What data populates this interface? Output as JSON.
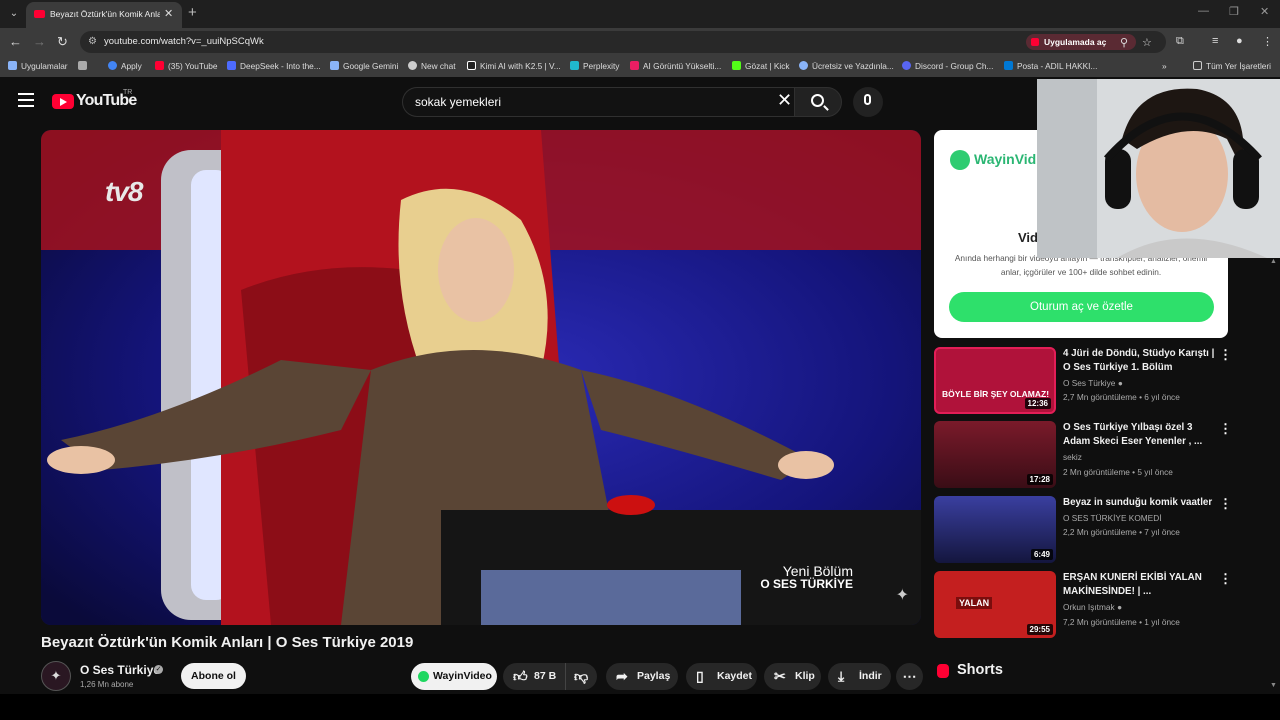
{
  "browser": {
    "tab_title": "Beyazıt Öztürk'ün Komik Anları",
    "url": "youtube.com/watch?v=_uuiNpSCqWk",
    "open_in_app": "Uygulamada aç",
    "bookmarks": [
      {
        "label": "Uygulamalar",
        "icon": "apps-grid-icon",
        "color": "#8ab4f8"
      },
      {
        "label": "Apply",
        "icon": "apply-icon",
        "color": "#4285f4"
      },
      {
        "label": "(35) YouTube",
        "icon": "youtube-icon",
        "color": "#ff0033"
      },
      {
        "label": "DeepSeek - Into the...",
        "icon": "deepseek-icon",
        "color": "#4d6bfe"
      },
      {
        "label": "Google Gemini",
        "icon": "gemini-icon",
        "color": "#8ab4f8"
      },
      {
        "label": "New chat",
        "icon": "chatgpt-icon",
        "color": "#cccccc"
      },
      {
        "label": "Kimi AI with K2.5 | V...",
        "icon": "kimi-icon",
        "color": "#ffffff"
      },
      {
        "label": "Perplexity",
        "icon": "perplexity-icon",
        "color": "#20b8cd"
      },
      {
        "label": "AI Görüntü Yükselti...",
        "icon": "upscale-icon",
        "color": "#e91e63"
      },
      {
        "label": "Gözat | Kick",
        "icon": "kick-icon",
        "color": "#53fc18"
      },
      {
        "label": "Ücretsiz ve Yazdınla...",
        "icon": "free-icon",
        "color": "#8ab4f8"
      },
      {
        "label": "Discord - Group Ch...",
        "icon": "discord-icon",
        "color": "#5865f2"
      },
      {
        "label": "Posta - ADIL HAKKI...",
        "icon": "mail-icon",
        "color": "#0078d4"
      }
    ],
    "all_bookmarks": "Tüm Yer İşaretleri"
  },
  "youtube": {
    "logo": "YouTube",
    "region": "TR",
    "search_query": "sokak yemekleri",
    "player": {
      "channel_logo": "tv8",
      "caption_line1": "Yeni Bölüm",
      "caption_line2": "O SES TÜRKİYE"
    },
    "video": {
      "title": "Beyazıt Öztürk'ün Komik Anları | O Ses Türkiye 2019",
      "channel": "O Ses Türkiye",
      "subscribers": "1,26 Mn abone",
      "subscribe": "Abone ol",
      "actions": {
        "wayin": "WayinVideo",
        "likes": "87 B",
        "share": "Paylaş",
        "save": "Kaydet",
        "clip": "Klip",
        "download": "İndir"
      }
    },
    "ad": {
      "brand": "WayinVid",
      "heading": "Vid",
      "description": "Anında herhangi bir videoyu anlayın — transkriptler, analizler, önemli anlar, içgörüler ve 100+ dilde sohbet edinin.",
      "cta": "Oturum aç ve özetle"
    },
    "recommendations": [
      {
        "title": "4 Jüri de Döndü, Stüdyo Karıştı | O Ses Türkiye 1. Bölüm",
        "channel": "O Ses Türkiye",
        "verified": true,
        "stats": "2,7 Mn görüntüleme • 6 yıl önce",
        "duration": "12:36",
        "thumb_text": "BÖYLE BİR ŞEY OLAMAZ!",
        "thumb_color": "#b0123a"
      },
      {
        "title": "O Ses Türkiye Yılbaşı özel 3 Adam Skeci Eser Yenenler , ...",
        "channel": "sekiz",
        "verified": false,
        "stats": "2 Mn görüntüleme • 5 yıl önce",
        "duration": "17:28",
        "thumb_text": "",
        "thumb_color": "#6b1526"
      },
      {
        "title": "Beyaz in sunduğu komik vaatler",
        "channel": "O SES TÜRKİYE KOMEDİ",
        "verified": false,
        "stats": "2,2 Mn görüntüleme • 7 yıl önce",
        "duration": "6:49",
        "thumb_text": "",
        "thumb_color": "#2a2f7a"
      },
      {
        "title": "ERŞAN KUNERİ EKİBİ YALAN MAKİNESİNDE! | ...",
        "channel": "Orkun Işıtmak",
        "verified": true,
        "stats": "7,2 Mn görüntüleme • 1 yıl önce",
        "duration": "29:55",
        "thumb_text": "YALAN",
        "thumb_color": "#c41f1f"
      }
    ],
    "shorts": "Shorts"
  }
}
